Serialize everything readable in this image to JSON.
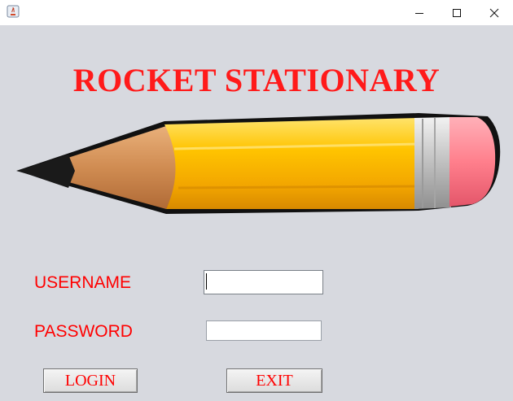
{
  "window": {
    "icon": "java-app-icon",
    "controls": [
      "minimize-icon",
      "maximize-icon",
      "close-icon"
    ]
  },
  "app": {
    "title": "ROCKET STATIONARY",
    "logo": "pencil-image"
  },
  "form": {
    "username_label": "USERNAME",
    "username_value": "",
    "password_label": "PASSWORD",
    "password_value": ""
  },
  "buttons": {
    "login_label": "LOGIN",
    "exit_label": "EXIT"
  },
  "colors": {
    "accent": "#ff0000",
    "background": "#d7d9df"
  }
}
